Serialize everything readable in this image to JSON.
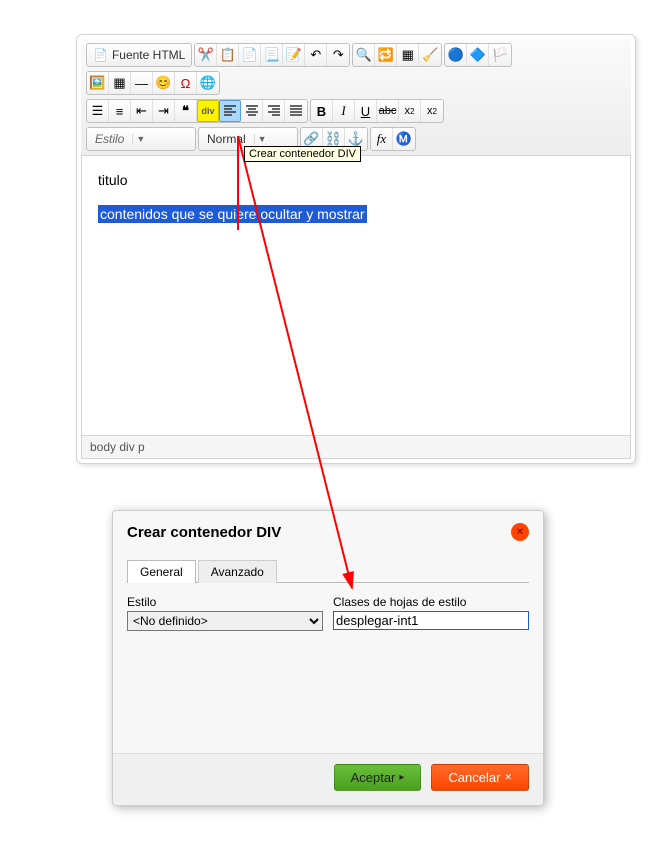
{
  "toolbar": {
    "source_label": "Fuente HTML",
    "style_combo": "Estilo",
    "format_combo": "Normal",
    "bold": "B",
    "italic": "I",
    "underline": "U",
    "tooltip": "Crear contenedor DIV"
  },
  "content": {
    "title_text": "titulo",
    "selected_text": "contenidos que se quiere ocultar y mostrar"
  },
  "statusbar": {
    "path": "body  div  p"
  },
  "dialog": {
    "title": "Crear contenedor DIV",
    "tab_general": "General",
    "tab_advanced": "Avanzado",
    "style_label": "Estilo",
    "style_value": "<No definido>",
    "class_label": "Clases de hojas de estilo",
    "class_value": "desplegar-int1",
    "accept": "Aceptar",
    "cancel": "Cancelar"
  }
}
